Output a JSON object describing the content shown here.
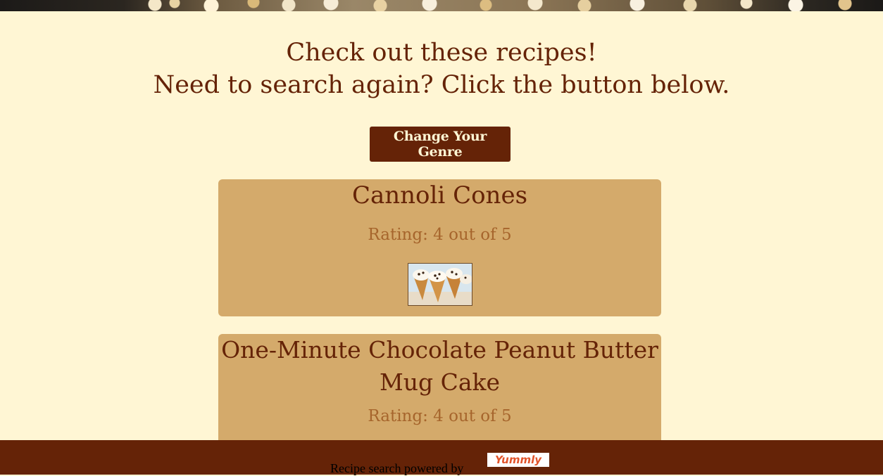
{
  "header": {
    "line1": "Check out these recipes!",
    "line2": "Need to search again? Click the button below."
  },
  "genre_button": {
    "label": "Change Your Genre"
  },
  "recipes": [
    {
      "title": "Cannoli Cones",
      "rating": "Rating: 4 out of 5",
      "image": "cannoli-cones-photo"
    },
    {
      "title": "One-Minute Chocolate Peanut Butter Mug Cake",
      "rating": "Rating: 4 out of 5"
    }
  ],
  "footer": {
    "text": "Recipe search powered by",
    "logo": "Yummly"
  },
  "colors": {
    "background": "#fff6d4",
    "brown": "#652307",
    "card": "#d4aa6b",
    "rating": "#a6652c",
    "yummly": "#e2542a"
  }
}
